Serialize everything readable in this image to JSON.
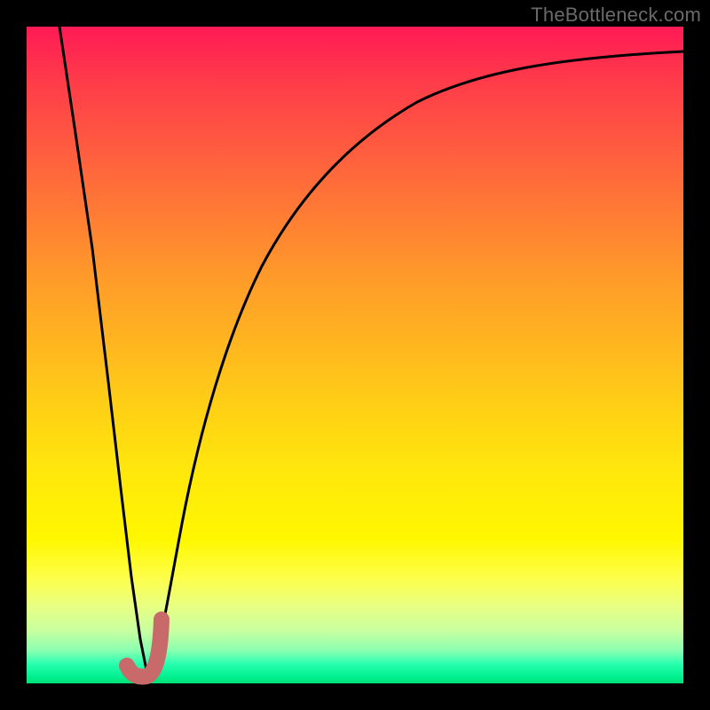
{
  "watermark": "TheBottleneck.com",
  "chart_data": {
    "type": "line",
    "title": "",
    "xlabel": "",
    "ylabel": "",
    "xlim": [
      0,
      100
    ],
    "ylim": [
      0,
      100
    ],
    "grid": false,
    "legend": false,
    "series": [
      {
        "name": "bottleneck-curve",
        "x": [
          4,
          6,
          8,
          10,
          12,
          14,
          16,
          18,
          20,
          23,
          26,
          30,
          35,
          40,
          46,
          53,
          62,
          72,
          84,
          100
        ],
        "y": [
          100,
          80,
          60,
          40,
          22,
          8,
          1,
          4,
          14,
          30,
          44,
          56,
          66,
          74,
          80,
          84,
          88,
          91,
          93,
          95
        ]
      }
    ],
    "marker": {
      "name": "sweet-spot-J",
      "approx_x_range": [
        13,
        18
      ],
      "approx_y_range": [
        0,
        9
      ]
    },
    "background_gradient": {
      "top": "#ff1a55",
      "mid_top": "#ffb520",
      "mid": "#fff700",
      "bottom": "#00e074"
    }
  }
}
